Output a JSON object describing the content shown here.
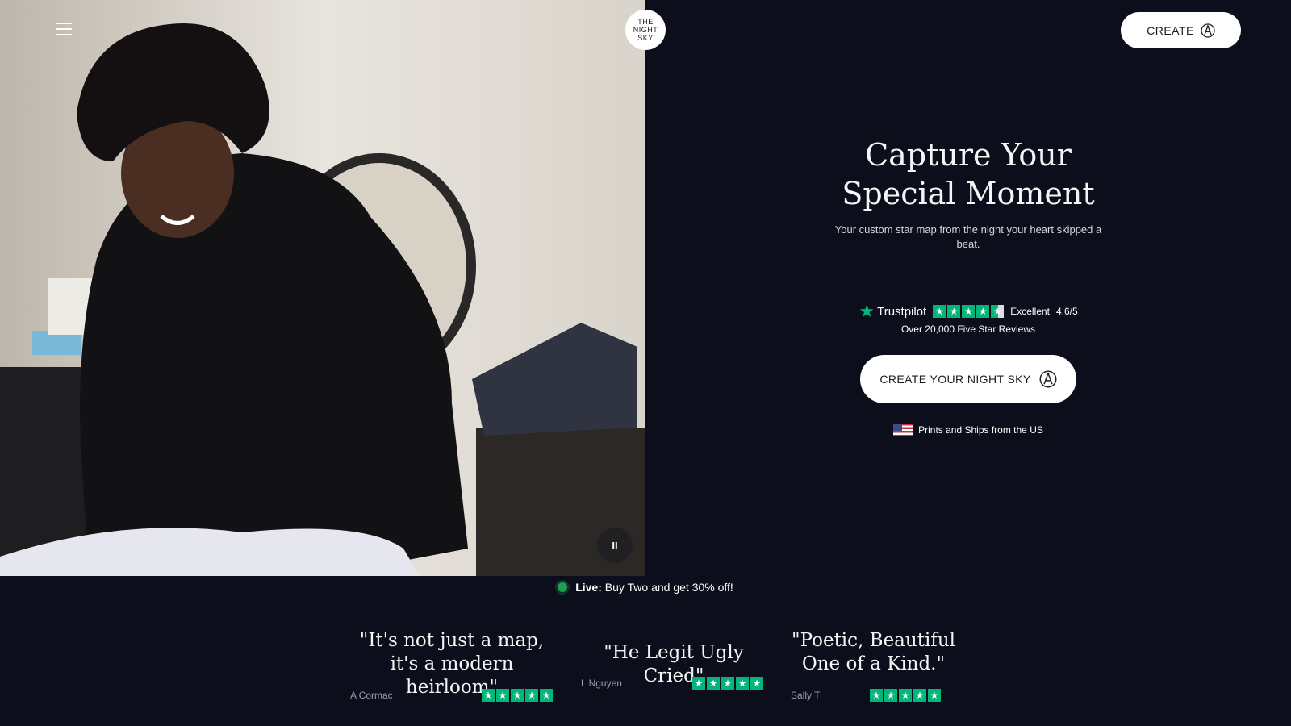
{
  "header": {
    "logo_line1": "THE",
    "logo_line2": "NIGHT",
    "logo_line3": "SKY",
    "create_label": "CREATE",
    "icons": [
      "menu-icon",
      "compass-icon"
    ]
  },
  "hero": {
    "title_line1": "Capture Your",
    "title_line2": "Special Moment",
    "subtitle": "Your custom star map from the night your heart skipped a beat.",
    "trustpilot_label": "Trustpilot",
    "rating_word": "Excellent",
    "rating_score": "4.6/5",
    "rating_stars": 4.6,
    "reviews_text": "Over 20,000 Five Star Reviews",
    "cta_label": "CREATE YOUR NIGHT SKY",
    "shipping_text": "Prints and Ships from the US"
  },
  "video": {
    "pause_symbol": "II"
  },
  "promo": {
    "live_label": "Live:",
    "text": "Buy Two and get 30% off!"
  },
  "testimonials": [
    {
      "quote_line1": "\"It's not just a map,",
      "quote_line2": "it's a modern heirloom\"",
      "author": "A Cormac",
      "stars": 5
    },
    {
      "quote_line1": "\"He Legit Ugly Cried\"",
      "quote_line2": "",
      "author": "L Nguyen",
      "stars": 5
    },
    {
      "quote_line1": "\"Poetic, Beautiful",
      "quote_line2": "One of a Kind.\"",
      "author": "Sally T",
      "stars": 5
    }
  ],
  "colors": {
    "background": "#0c0f1b",
    "trustpilot_green": "#00b67a",
    "live_dot": "#1f9d55",
    "button_bg": "#ffffff"
  }
}
